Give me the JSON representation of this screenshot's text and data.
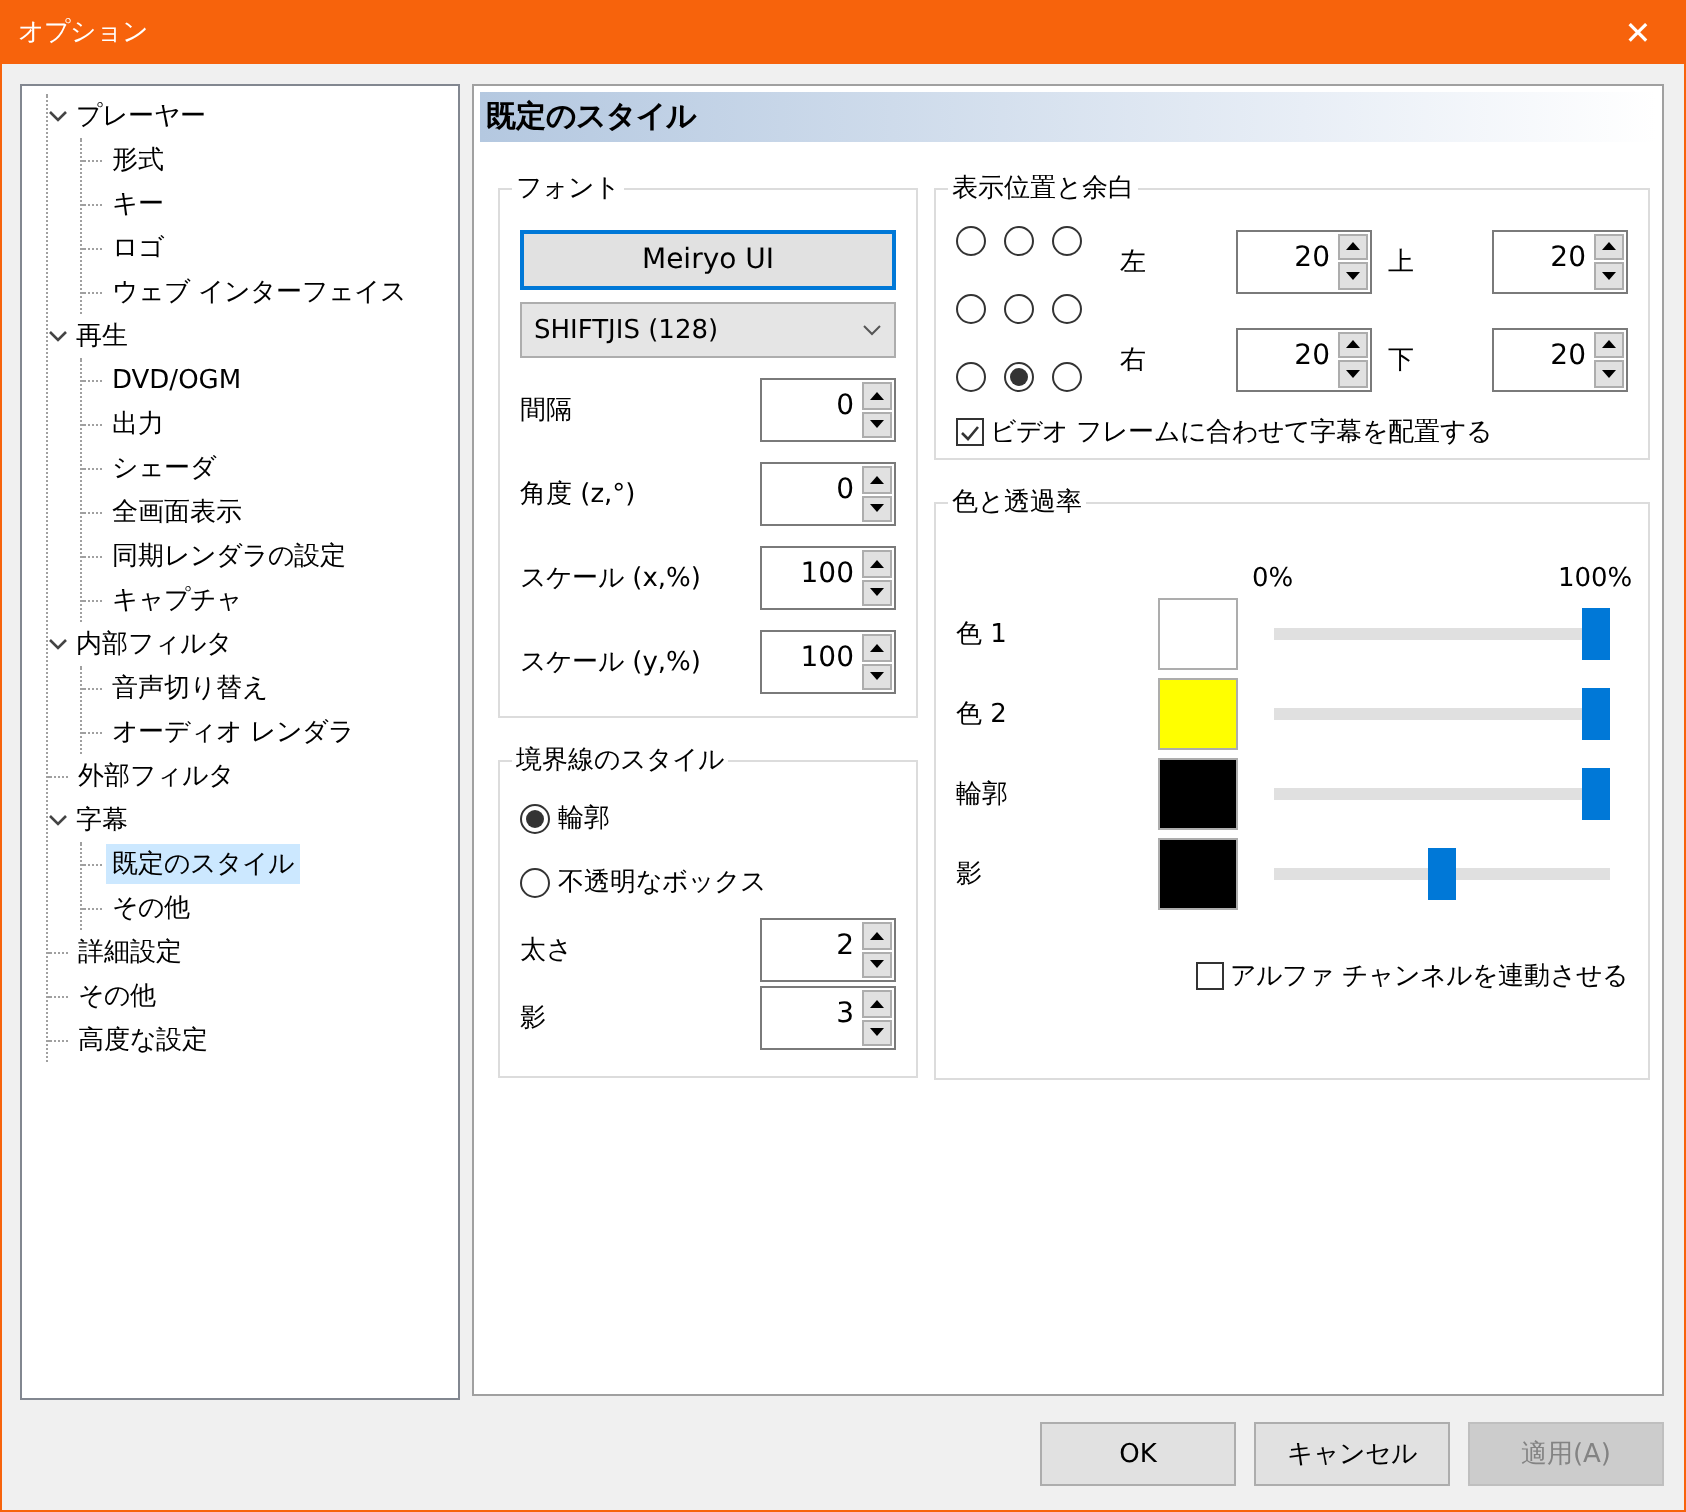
{
  "window": {
    "title": "オプション",
    "close": "✕"
  },
  "tree": [
    {
      "label": "プレーヤー",
      "expanded": true,
      "selected": false,
      "children": [
        {
          "label": "形式",
          "selected": false
        },
        {
          "label": "キー",
          "selected": false
        },
        {
          "label": "ロゴ",
          "selected": false
        },
        {
          "label": "ウェブ インターフェイス",
          "selected": false
        }
      ]
    },
    {
      "label": "再生",
      "expanded": true,
      "selected": false,
      "children": [
        {
          "label": "DVD/OGM",
          "selected": false
        },
        {
          "label": "出力",
          "selected": false
        },
        {
          "label": "シェーダ",
          "selected": false
        },
        {
          "label": "全画面表示",
          "selected": false
        },
        {
          "label": "同期レンダラの設定",
          "selected": false
        },
        {
          "label": "キャプチャ",
          "selected": false
        }
      ]
    },
    {
      "label": "内部フィルタ",
      "expanded": true,
      "selected": false,
      "children": [
        {
          "label": "音声切り替え",
          "selected": false
        },
        {
          "label": "オーディオ レンダラ",
          "selected": false
        }
      ]
    },
    {
      "label": "外部フィルタ",
      "selected": false
    },
    {
      "label": "字幕",
      "expanded": true,
      "selected": false,
      "children": [
        {
          "label": "既定のスタイル",
          "selected": true
        },
        {
          "label": "その他",
          "selected": false
        }
      ]
    },
    {
      "label": "詳細設定",
      "selected": false
    },
    {
      "label": "その他",
      "selected": false
    },
    {
      "label": "高度な設定",
      "selected": false
    }
  ],
  "page_title": "既定のスタイル",
  "font_group": {
    "title": "フォント",
    "font_button": "Meiryo UI",
    "charset": "SHIFTJIS (128)",
    "spins": [
      {
        "label": "間隔",
        "value": "0"
      },
      {
        "label": "角度 (z,°)",
        "value": "0"
      },
      {
        "label": "スケール (x,%)",
        "value": "100"
      },
      {
        "label": "スケール (y,%)",
        "value": "100"
      }
    ]
  },
  "border_group": {
    "title": "境界線のスタイル",
    "options": [
      {
        "label": "輪郭",
        "selected": true
      },
      {
        "label": "不透明なボックス",
        "selected": false
      }
    ],
    "spins": [
      {
        "label": "太さ",
        "value": "2"
      },
      {
        "label": "影",
        "value": "3"
      }
    ]
  },
  "position_group": {
    "title": "表示位置と余白",
    "alignment": [
      {
        "selected": false
      },
      {
        "selected": false
      },
      {
        "selected": false
      },
      {
        "selected": false
      },
      {
        "selected": false
      },
      {
        "selected": false
      },
      {
        "selected": false
      },
      {
        "selected": true
      },
      {
        "selected": false
      }
    ],
    "margins": [
      {
        "label": "左",
        "value": "20"
      },
      {
        "label": "上",
        "value": "20"
      },
      {
        "label": "右",
        "value": "20"
      },
      {
        "label": "下",
        "value": "20"
      }
    ],
    "checkbox": {
      "label": "ビデオ フレームに合わせて字幕を配置する",
      "checked": true
    }
  },
  "color_group": {
    "title": "色と透過率",
    "scale_min": "0%",
    "scale_max": "100%",
    "rows": [
      {
        "label": "色 1",
        "color": "#ffffff",
        "level": 1
      },
      {
        "label": "色 2",
        "color": "#ffff00",
        "level": 1
      },
      {
        "label": "輪郭",
        "color": "#000000",
        "level": 1
      },
      {
        "label": "影",
        "color": "#000000",
        "level": 0.5
      }
    ],
    "checkbox": {
      "label": "アルファ チャンネルを連動させる",
      "checked": false
    }
  },
  "buttons": [
    {
      "label": "OK",
      "disabled": false
    },
    {
      "label": "キャンセル",
      "disabled": false
    },
    {
      "label": "適用(A)",
      "disabled": true
    }
  ]
}
